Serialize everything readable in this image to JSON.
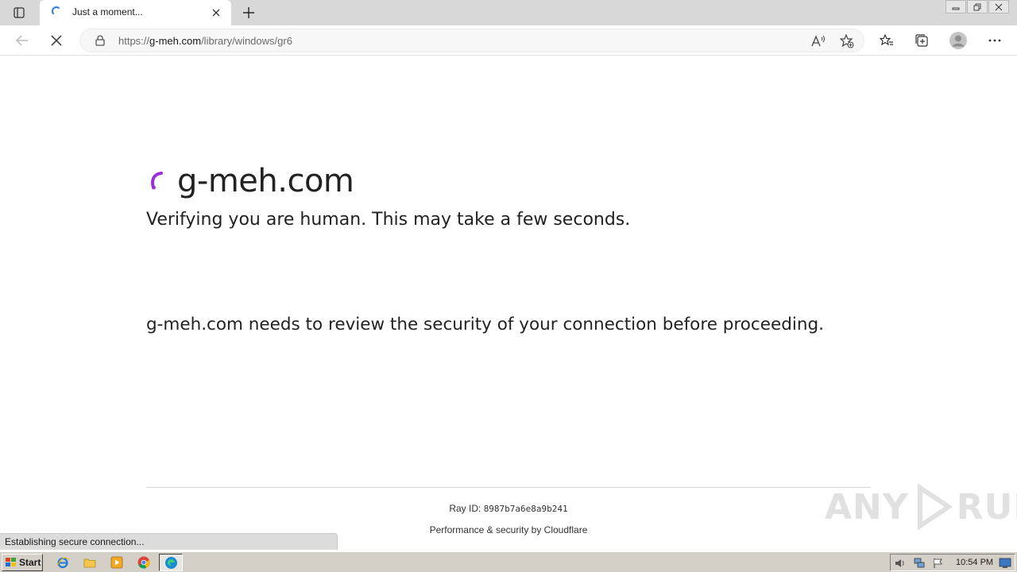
{
  "browser": {
    "tab": {
      "title": "Just a moment...",
      "favicon": "cloudflare-spinner-icon"
    },
    "address_bar": {
      "url_prefix": "https://",
      "url_host": "g-meh.com",
      "url_path": "/library/windows/gr6"
    },
    "status_bubble": "Establishing secure connection..."
  },
  "page": {
    "site_title": "g-meh.com",
    "verifying_text": "Verifying you are human. This may take a few seconds.",
    "review_text": "g-meh.com needs to review the security of your connection before proceeding.",
    "ray_label": "Ray ID: ",
    "ray_id": "8987b7a6e8a9b241",
    "performance": "Performance & security by Cloudflare",
    "accent_color": "#9b2fd8"
  },
  "watermark": {
    "text_left": "ANY",
    "text_right": "RUN"
  },
  "taskbar": {
    "start_label": "Start",
    "clock": "10:54 PM"
  }
}
